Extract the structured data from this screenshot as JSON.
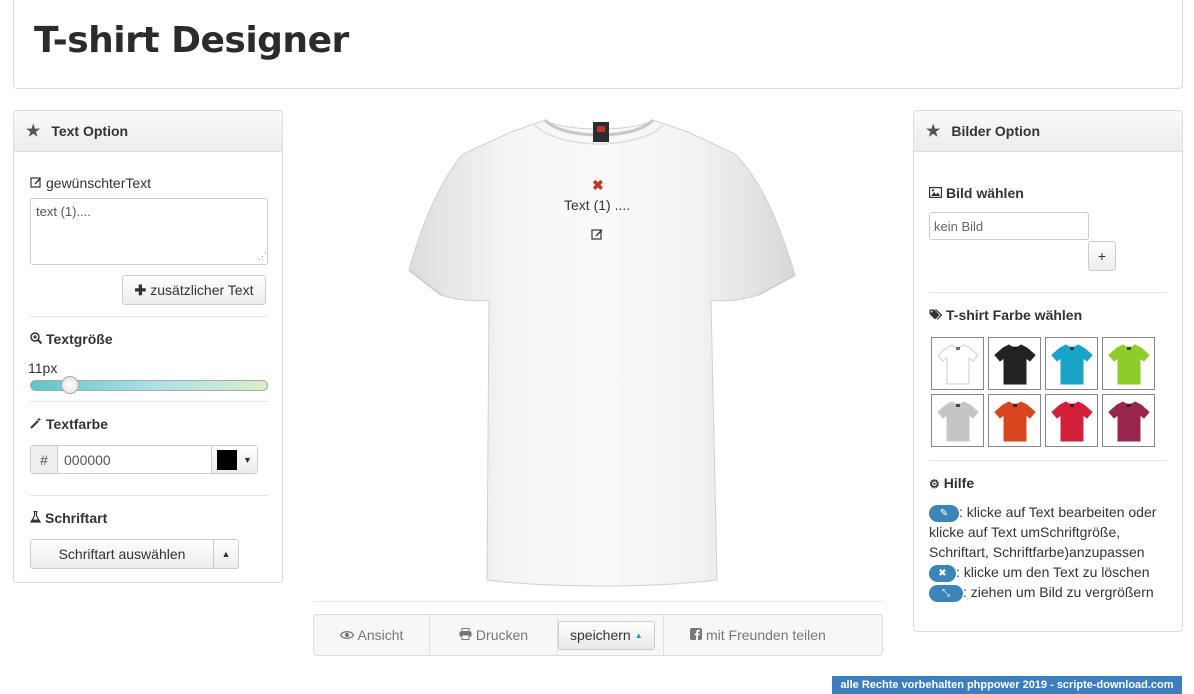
{
  "header": {
    "title": "T-shirt Designer"
  },
  "text_panel": {
    "title": "Text Option",
    "wanted_text_label": "gewünschterText",
    "text_value": "text (1)....",
    "add_text_button": "zusätzlicher Text",
    "size_label": "Textgröße",
    "size_value": "11px",
    "size_slider_fraction": 0.12,
    "color_label": "Textfarbe",
    "hash_symbol": "#",
    "color_hex": "000000",
    "color_swatch": "#000000",
    "font_label": "Schriftart",
    "font_select_button": "Schriftart auswählen"
  },
  "canvas": {
    "placed_text": "Text (1) ....",
    "shirt_color": "#ffffff"
  },
  "toolbar": {
    "view_label": "Ansicht",
    "print_label": "Drucken",
    "save_label": "speichern",
    "share_label": "mit Freunden teilen"
  },
  "image_panel": {
    "title": "Bilder Option",
    "choose_image_label": "Bild wählen",
    "file_placeholder": "kein Bild",
    "add_button": "+",
    "shirt_color_label": "T-shirt Farbe wählen",
    "shirt_colors": [
      "#ffffff",
      "#222222",
      "#1aa3c8",
      "#8dcc2b",
      "#c4c6c5",
      "#d8461f",
      "#d3203a",
      "#98254e"
    ],
    "help_title": "Hilfe",
    "help_edit": ": klicke auf Text bearbeiten oder klicke auf Text umSchriftgröße, Schriftart, Schriftfarbe)anzupassen",
    "help_delete": ": klicke um den Text zu löschen",
    "help_resize": ": ziehen um Bild zu vergrößern"
  },
  "footer": {
    "text": "alle Rechte vorbehalten phppower 2019 - scripte-download.com"
  }
}
